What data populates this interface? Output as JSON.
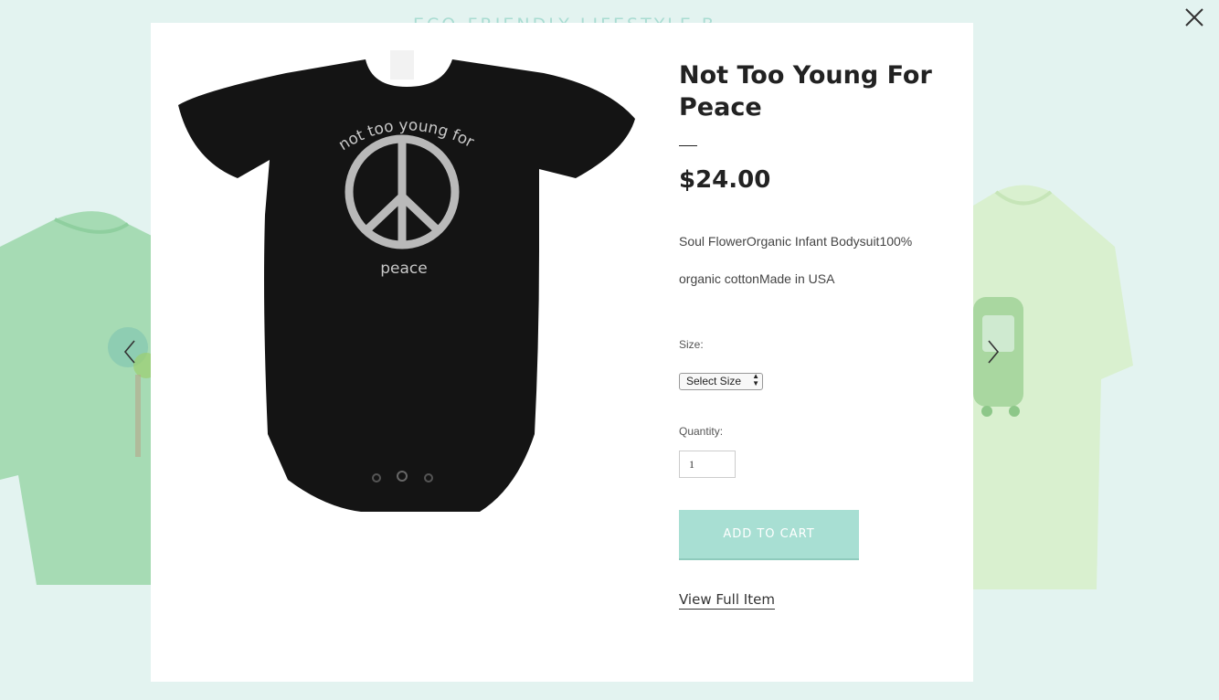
{
  "page": {
    "brand": "ECO-FRIENDLY LIFESTYLE BRAND"
  },
  "icons": {
    "close": "close-icon",
    "prev": "chevron-left-icon",
    "next": "chevron-right-icon"
  },
  "colors": {
    "background": "#e3f3f0",
    "accent": "#a8dfd3"
  },
  "product": {
    "image_print_top": "not too young for",
    "image_print_bottom": "peace",
    "title": "Not Too Young For Peace",
    "price": "$24.00",
    "description": "Soul FlowerOrganic Infant Bodysuit100% organic cottonMade in USA",
    "size_label": "Size:",
    "size_selected": "Select Size",
    "quantity_label": "Quantity:",
    "quantity_value": "1",
    "add_to_cart_label": "ADD TO CART",
    "view_full_label": "View Full Item"
  }
}
